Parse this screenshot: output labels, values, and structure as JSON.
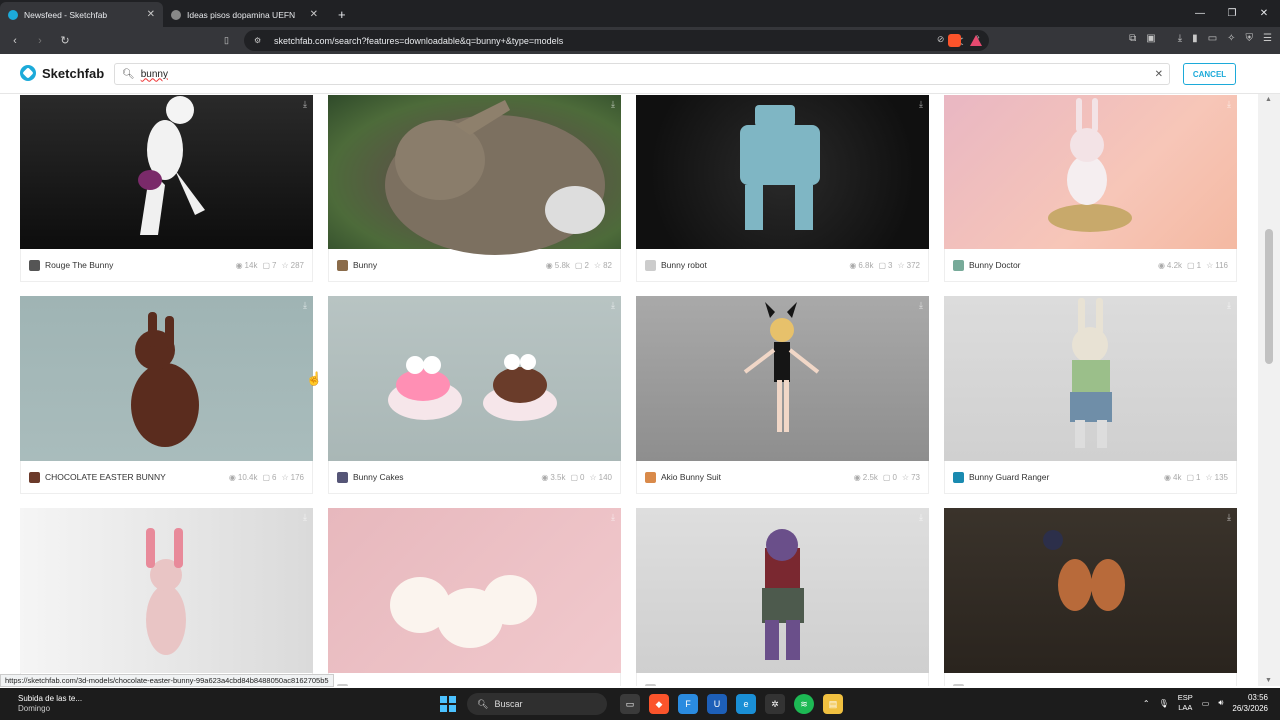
{
  "browser": {
    "tabs": [
      {
        "title": "Newsfeed - Sketchfab",
        "active": true
      },
      {
        "title": "Ideas pisos dopamina UEFN",
        "active": false
      }
    ],
    "url": "sketchfab.com/search?features=downloadable&q=bunny+&type=models",
    "status_url": "https://sketchfab.com/3d-models/chocolate-easter-bunny-99a623a4cbd84b8488050ac8162705b5"
  },
  "site": {
    "brand": "Sketchfab",
    "search_value": "bunny",
    "cancel_label": "CANCEL"
  },
  "results": [
    {
      "name": "Rouge The Bunny",
      "views": "14k",
      "comments": "7",
      "likes": "287",
      "bg": "linear-gradient(180deg,#2a2a2a,#0d0d0d)",
      "av": "#555"
    },
    {
      "name": "Bunny",
      "views": "5.8k",
      "comments": "2",
      "likes": "82",
      "bg": "radial-gradient(ellipse at 55% 55%,#7a6e5e 0%,#5a5346 35%,#4d6b3a 70%,#2f4a2a 100%)",
      "av": "#8a6b4a"
    },
    {
      "name": "Bunny robot",
      "views": "6.8k",
      "comments": "3",
      "likes": "372",
      "bg": "radial-gradient(circle at 50% 50%,#2a2a2a 0%,#101010 80%)",
      "av": "#ccc"
    },
    {
      "name": "Bunny Doctor",
      "views": "4.2k",
      "comments": "1",
      "likes": "116",
      "bg": "linear-gradient(135deg,#e9b7c3 0%,#f7c6b8 60%,#f4b9a2 100%)",
      "av": "#7a9"
    },
    {
      "name": "CHOCOLATE EASTER BUNNY",
      "views": "10.4k",
      "comments": "6",
      "likes": "176",
      "bg": "linear-gradient(180deg,#9fb4b4 0%,#a9bcbc 100%)",
      "av": "#6b3a2a"
    },
    {
      "name": "Bunny Cakes",
      "views": "3.5k",
      "comments": "0",
      "likes": "140",
      "bg": "linear-gradient(180deg,#b8c4c3 0%,#a9b7b6 100%)",
      "av": "#557"
    },
    {
      "name": "Akio Bunny Suit",
      "views": "2.5k",
      "comments": "0",
      "likes": "73",
      "bg": "linear-gradient(180deg,#a9a9a9 0%,#8e8e8e 100%)",
      "av": "#d98a4a"
    },
    {
      "name": "Bunny Guard Ranger",
      "views": "4k",
      "comments": "1",
      "likes": "135",
      "bg": "linear-gradient(180deg,#dcdcdc 0%,#d0d0d0 100%)",
      "av": "#1a8ab0"
    },
    {
      "name": "",
      "views": "",
      "comments": "",
      "likes": "",
      "bg": "linear-gradient(90deg,#f5f5f5 0%,#dadada 100%)",
      "av": "#ccc"
    },
    {
      "name": "",
      "views": "",
      "comments": "",
      "likes": "",
      "bg": "linear-gradient(135deg,#e7b8bd 0%,#f1c9cd 100%)",
      "av": "#ccc"
    },
    {
      "name": "",
      "views": "",
      "comments": "",
      "likes": "",
      "bg": "linear-gradient(180deg,#dedede 0%,#cfcfcf 100%)",
      "av": "#ccc"
    },
    {
      "name": "",
      "views": "",
      "comments": "",
      "likes": "",
      "bg": "linear-gradient(180deg,#3a332b 0%,#2a241e 100%)",
      "av": "#ccc"
    }
  ],
  "taskbar": {
    "weather_title": "Subida de las te...",
    "weather_sub": "Domingo",
    "search_placeholder": "Buscar",
    "lang_top": "ESP",
    "lang_bottom": "LAA",
    "time": "03:56",
    "date": "26/3/2026"
  }
}
